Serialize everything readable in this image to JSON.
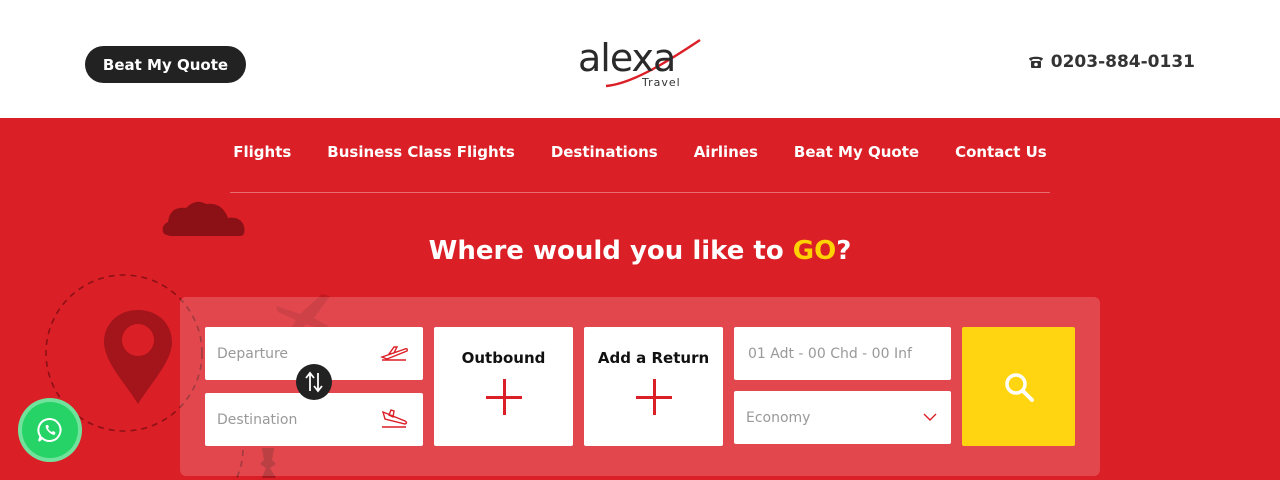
{
  "header": {
    "quote_button": "Beat My Quote",
    "logo": {
      "word": "alexa",
      "sub": "Travel"
    },
    "phone": "0203-884-0131",
    "phone_icon": "phone-icon"
  },
  "nav": {
    "items": [
      "Flights",
      "Business Class Flights",
      "Destinations",
      "Airlines",
      "Beat My Quote",
      "Contact Us"
    ]
  },
  "hero": {
    "headline_prefix": "Where would you like to ",
    "headline_highlight": "GO",
    "headline_suffix": "?"
  },
  "search": {
    "departure_placeholder": "Departure",
    "destination_placeholder": "Destination",
    "outbound_label": "Outbound",
    "return_label": "Add a Return",
    "passengers_placeholder": "01 Adt - 00 Chd - 00 Inf",
    "cabin_value": "Economy"
  },
  "colors": {
    "brand_red": "#db1f26",
    "accent_yellow": "#ffd200",
    "search_button": "#ffd411",
    "whatsapp_green": "#25d366"
  }
}
